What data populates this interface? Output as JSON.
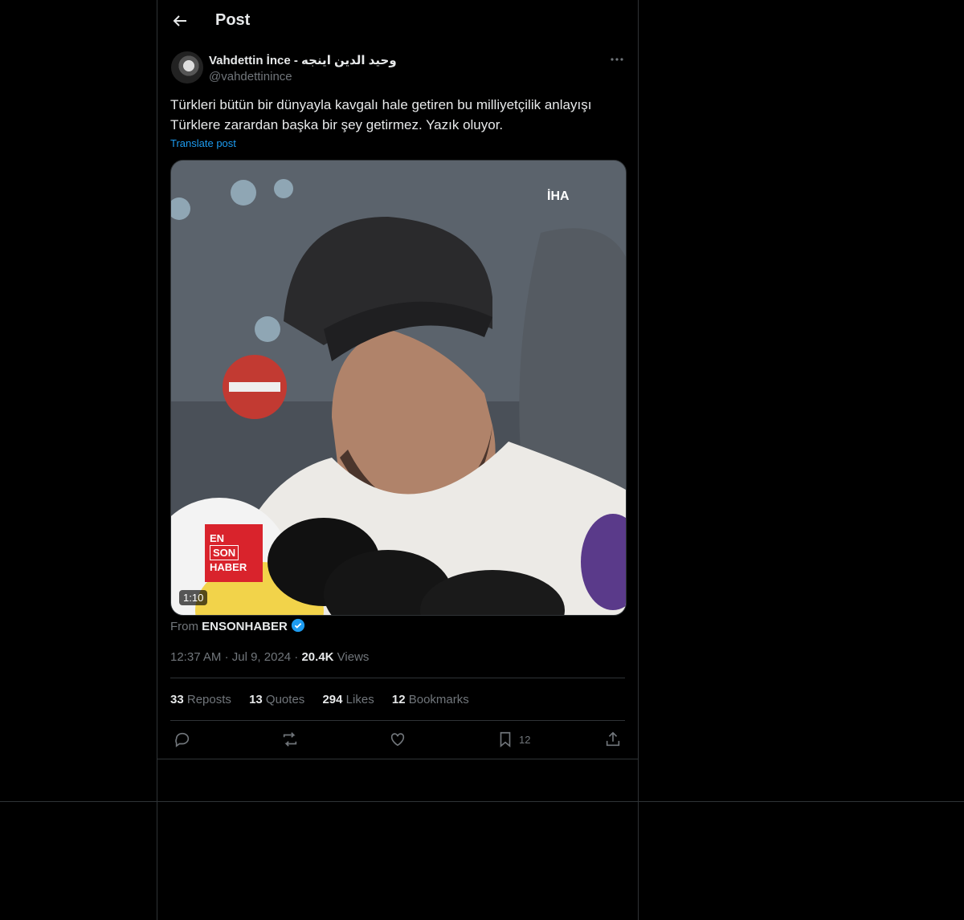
{
  "header": {
    "title": "Post"
  },
  "post": {
    "author_name": "Vahdettin İnce - وحيد الدين اينجه",
    "author_handle": "@vahdettinince",
    "text": "Türkleri bütün bir dünyayla kavgalı hale getiren bu milliyetçilik anlayışı Türklere zarardan başka bir şey getirmez. Yazık oluyor.",
    "translate_label": "Translate post",
    "media": {
      "duration": "1:10",
      "watermark": "İHA",
      "logo_lines": [
        "EN",
        "SON",
        "HABER"
      ]
    },
    "from_label": "From",
    "from_source": "ENSONHABER",
    "time": "12:37 AM",
    "date": "Jul 9, 2024",
    "views_count": "20.4K",
    "views_label": "Views",
    "stats": {
      "reposts_count": "33",
      "reposts_label": "Reposts",
      "quotes_count": "13",
      "quotes_label": "Quotes",
      "likes_count": "294",
      "likes_label": "Likes",
      "bookmarks_count": "12",
      "bookmarks_label": "Bookmarks"
    },
    "actions": {
      "bookmark_count": "12"
    }
  },
  "colors": {
    "background": "#000000",
    "border": "#2f3336",
    "link": "#1d9bf0",
    "muted": "#71767b",
    "verified": "#1d9bf0"
  },
  "icons": [
    "back-arrow-icon",
    "more-icon",
    "verified-badge-icon",
    "reply-icon",
    "repost-icon",
    "like-icon",
    "bookmark-icon",
    "share-icon"
  ]
}
